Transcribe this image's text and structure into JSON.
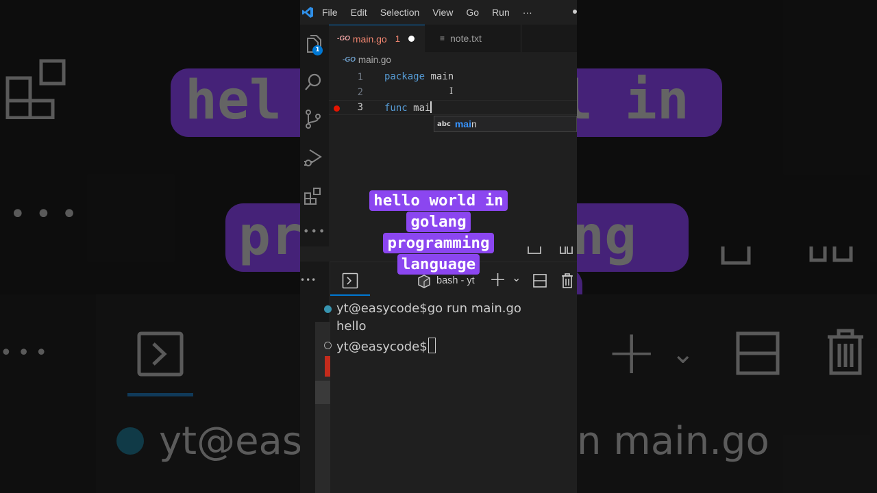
{
  "menu": [
    "File",
    "Edit",
    "Selection",
    "View",
    "Go",
    "Run",
    "···"
  ],
  "activity": {
    "explorer_badge": "1"
  },
  "tabs": [
    {
      "icon": "-GO",
      "label": "main.go",
      "problems": "1",
      "modified": true
    },
    {
      "label": "note.txt"
    }
  ],
  "breadcrumb": {
    "icon": "-GO",
    "file": "main.go"
  },
  "editor": {
    "lines": [
      {
        "number": "1",
        "keyword": "package",
        "text": " main"
      },
      {
        "number": "2",
        "keyword": "",
        "text": ""
      },
      {
        "number": "3",
        "keyword": "func",
        "text": " mai",
        "breakpoint": true
      }
    ],
    "suggestion": {
      "kind": "abc",
      "match": "mai",
      "rest": "n"
    }
  },
  "terminal": {
    "title": "bash - yt",
    "lines": [
      {
        "text": "yt@easycode$go run main.go"
      },
      {
        "text": "hello"
      },
      {
        "text": "yt@easycode$"
      }
    ]
  },
  "caption": [
    "hello world in",
    "golang",
    "programming",
    "language"
  ],
  "background": {
    "caption_fragments": [
      "hel",
      "l in",
      "pr",
      "ng"
    ],
    "terminal_text": [
      "yt@eas",
      "n main.go"
    ]
  },
  "colors": {
    "caption": "#8b46f0",
    "accent": "#0078d4",
    "breakpoint": "#e51400"
  }
}
